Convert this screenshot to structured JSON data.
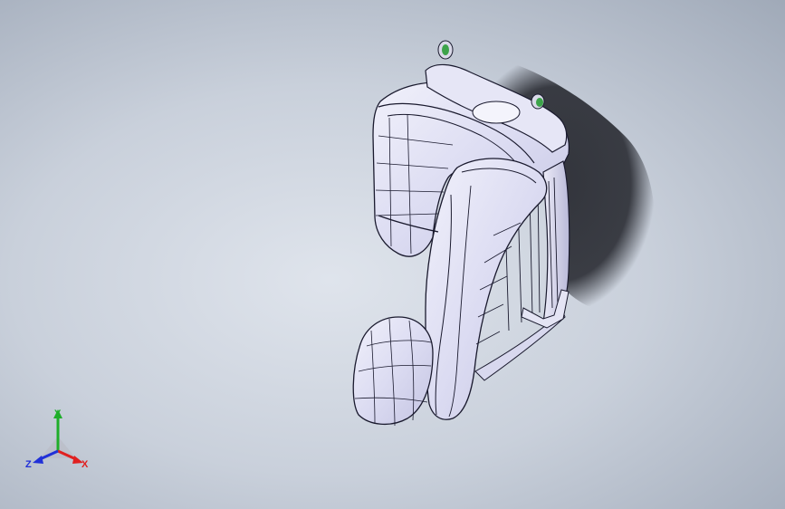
{
  "viewport": {
    "background_top": "#dfe4ec",
    "background_edge": "#98a2b1",
    "model_color": "#e3e3f6",
    "model_edge_color": "#1a1a2e",
    "shadow_color": "#2a2c33",
    "accent_green": "#3da34a"
  },
  "triad": {
    "x_label": "X",
    "y_label": "Y",
    "z_label": "Z",
    "x_color": "#e02020",
    "y_color": "#1fae2a",
    "z_color": "#2030d8"
  }
}
